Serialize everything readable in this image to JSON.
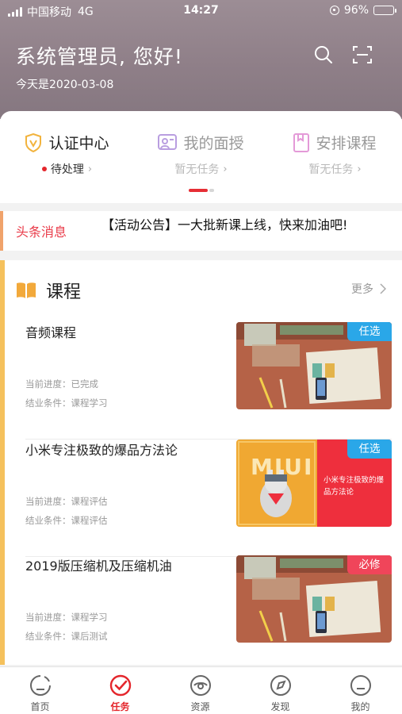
{
  "status_bar": {
    "carrier": "中国移动",
    "network": "4G",
    "time": "14:27",
    "battery": "96%"
  },
  "header": {
    "greeting": "系统管理员, 您好!",
    "date_line": "今天是2020-03-08",
    "icons": [
      "search-icon",
      "scan-icon"
    ]
  },
  "tabs": [
    {
      "label": "认证中心",
      "sub": "待处理",
      "icon": "certification-icon",
      "active": true
    },
    {
      "label": "我的面授",
      "sub": "暂无任务",
      "icon": "face-teaching-icon",
      "active": false
    },
    {
      "label": "安排课程",
      "sub": "暂无任务",
      "icon": "schedule-icon",
      "active": false
    }
  ],
  "headline": {
    "tag": "头条消息",
    "text": "【活动公告】一大批新课上线，快来加油吧!"
  },
  "courses_section": {
    "title": "课程",
    "more": "更多",
    "items": [
      {
        "name": "音频课程",
        "progress_label": "当前进度：",
        "progress": "已完成",
        "condition_label": "结业条件：",
        "condition": "课程学习",
        "badge": "任选",
        "badge_color": "#2aa7e8",
        "thumb": "desk-photo"
      },
      {
        "name": "小米专注极致的爆品方法论",
        "progress_label": "当前进度：",
        "progress": "课程评估",
        "condition_label": "结业条件：",
        "condition": "课程评估",
        "badge": "任选",
        "badge_color": "#2aa7e8",
        "thumb": "mi-bunny",
        "thumb_caption": "小米专注极致的爆品方法论"
      },
      {
        "name": "2019版压缩机及压缩机油",
        "progress_label": "当前进度：",
        "progress": "课程学习",
        "condition_label": "结业条件：",
        "condition": "课后测试",
        "badge": "必修",
        "badge_color": "#f0455a",
        "thumb": "desk-photo"
      }
    ]
  },
  "bottom_nav": [
    {
      "label": "首页",
      "icon": "home-icon",
      "active": false
    },
    {
      "label": "任务",
      "icon": "task-icon",
      "active": true
    },
    {
      "label": "资源",
      "icon": "resource-icon",
      "active": false
    },
    {
      "label": "发现",
      "icon": "discover-icon",
      "active": false
    },
    {
      "label": "我的",
      "icon": "profile-icon",
      "active": false
    }
  ],
  "colors": {
    "accent": "#e4262c",
    "header_bg": "#8f7f88",
    "badge_optional": "#2aa7e8",
    "badge_required": "#f0455a"
  }
}
